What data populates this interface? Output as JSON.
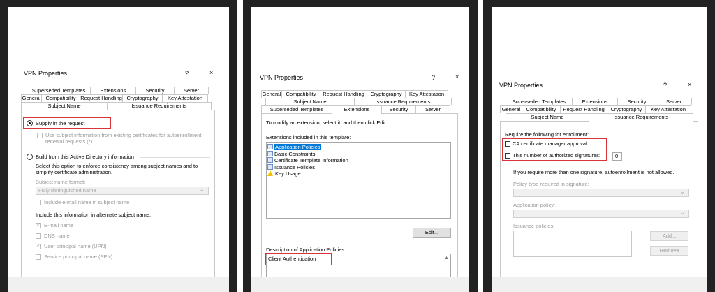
{
  "dialog_title": "VPN Properties",
  "help_glyph": "?",
  "close_glyph": "×",
  "tabs": {
    "superseded": "Superseded Templates",
    "extensions": "Extensions",
    "security": "Security",
    "server": "Server",
    "general": "General",
    "compatibility": "Compatibility",
    "request_handling": "Request Handling",
    "cryptography": "Cryptography",
    "key_attestation": "Key Attestation",
    "subject_name": "Subject Name",
    "issuance": "Issuance Requirements"
  },
  "panel1": {
    "supply": "Supply in the request",
    "use_subject_line1": "Use subject information from existing certificates for autoenrollment",
    "use_subject_line2": "renewal requests (*)",
    "build": "Build from this Active Directory information",
    "build_desc1": "Select this option to enforce consistency among subject names and to",
    "build_desc2": "simplify certificate administration.",
    "format_label": "Subject name format:",
    "format_value": "Fully distinguished name",
    "include_email": "Include e-mail name in subject name",
    "alt_heading": "Include this information in alternate subject name:",
    "alt_email": "E-mail name",
    "alt_dns": "DNS name",
    "alt_upn": "User principal name (UPN)",
    "alt_spn": "Service principal name (SPN)"
  },
  "panel2": {
    "intro": "To modify an extension, select it, and then click Edit.",
    "list_label": "Extensions included in this template:",
    "extensions": [
      "Application Policies",
      "Basic Constraints",
      "Certificate Template Information",
      "Issuance Policies",
      "Key Usage"
    ],
    "edit_button": "Edit...",
    "desc_label": "Description of Application Policies:",
    "desc_value": "Client Authentication"
  },
  "panel3": {
    "require_label": "Require the following for enrollment:",
    "ca_approval": "CA certificate manager approval",
    "num_signatures": "This number of authorized signatures:",
    "num_value": "0",
    "more_than_one": "If you require more than one signature, autoenrollment is not allowed.",
    "policy_type_label": "Policy type required in signature:",
    "app_policy_label": "Application policy:",
    "issuance_policies_label": "Issuance policies:",
    "add_button": "Add...",
    "remove_button": "Remove"
  },
  "colors": {
    "highlight": "#d9343a",
    "selection": "#0078d7",
    "frame": "#222222"
  }
}
